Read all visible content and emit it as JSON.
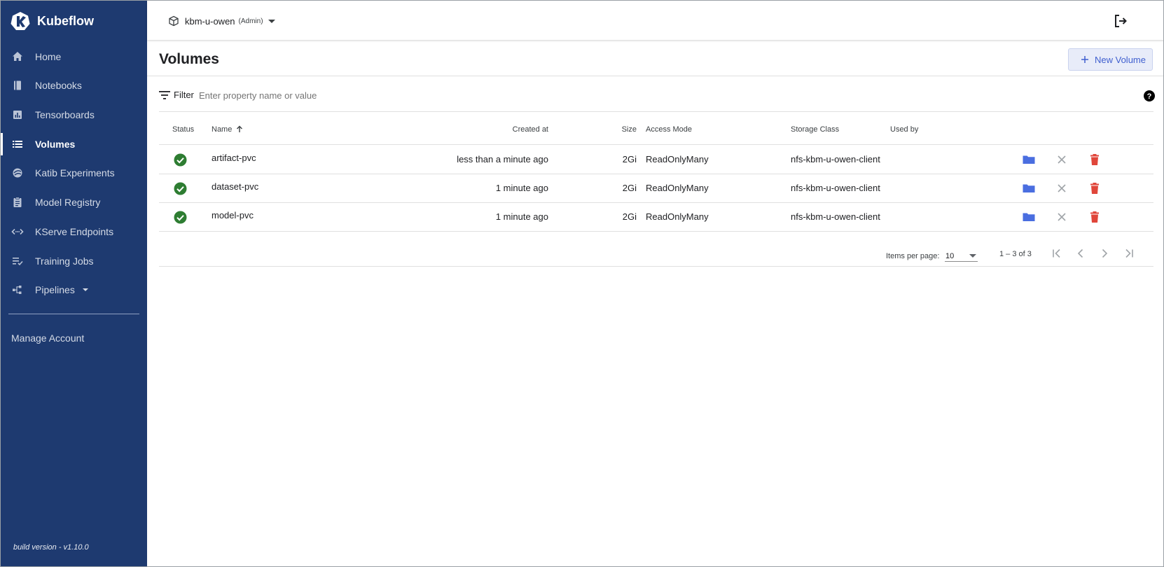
{
  "app": {
    "name": "Kubeflow"
  },
  "sidebar": {
    "items": [
      {
        "label": "Home",
        "icon": "home-icon",
        "active": false
      },
      {
        "label": "Notebooks",
        "icon": "book-icon",
        "active": false
      },
      {
        "label": "Tensorboards",
        "icon": "bar-chart-icon",
        "active": false
      },
      {
        "label": "Volumes",
        "icon": "list-icon",
        "active": true
      },
      {
        "label": "Katib Experiments",
        "icon": "katib-icon",
        "active": false
      },
      {
        "label": "Model Registry",
        "icon": "clipboard-icon",
        "active": false
      },
      {
        "label": "KServe Endpoints",
        "icon": "code-arrows-icon",
        "active": false
      },
      {
        "label": "Training Jobs",
        "icon": "checklist-icon",
        "active": false
      },
      {
        "label": "Pipelines",
        "icon": "pipeline-icon",
        "active": false
      }
    ],
    "manage_account": "Manage Account",
    "build_version": "build version - v1.10.0"
  },
  "header": {
    "namespace": "kbm-u-owen",
    "role": "(Admin)"
  },
  "page": {
    "title": "Volumes",
    "new_button": "New Volume"
  },
  "filter": {
    "label": "Filter",
    "placeholder": "Enter property name or value"
  },
  "table": {
    "columns": {
      "status": "Status",
      "name": "Name",
      "created": "Created at",
      "size": "Size",
      "access": "Access Mode",
      "storage": "Storage Class",
      "used_by": "Used by"
    },
    "rows": [
      {
        "name": "artifact-pvc",
        "created": "less than a minute ago",
        "size": "2Gi",
        "access": "ReadOnlyMany",
        "storage": "nfs-kbm-u-owen-client",
        "used_by": ""
      },
      {
        "name": "dataset-pvc",
        "created": "1 minute ago",
        "size": "2Gi",
        "access": "ReadOnlyMany",
        "storage": "nfs-kbm-u-owen-client",
        "used_by": ""
      },
      {
        "name": "model-pvc",
        "created": "1 minute ago",
        "size": "2Gi",
        "access": "ReadOnlyMany",
        "storage": "nfs-kbm-u-owen-client",
        "used_by": ""
      }
    ]
  },
  "paginator": {
    "items_per_page_label": "Items per page:",
    "items_per_page": "10",
    "range": "1 – 3 of 3"
  },
  "colors": {
    "sidebar": "#1e3a70",
    "status_ok": "#2e7d32",
    "folder": "#4a6ee0",
    "delete": "#e0463a",
    "accent": "#3f5fcf"
  }
}
